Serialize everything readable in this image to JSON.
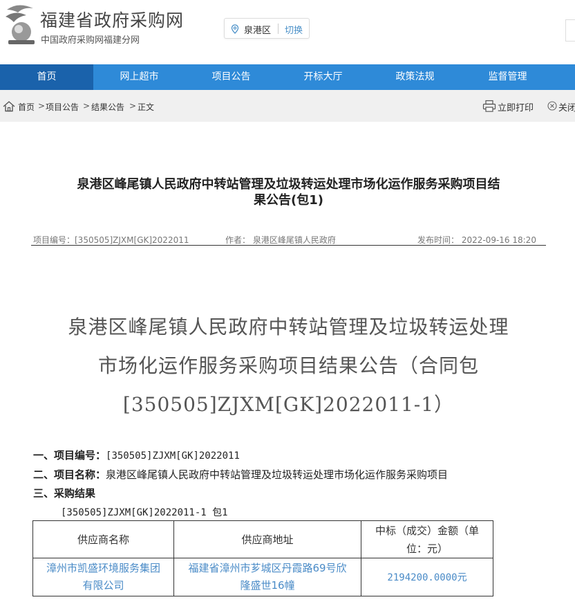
{
  "header": {
    "title": "福建省政府采购网",
    "subtitle": "中国政府采购网福建分网",
    "region": "泉港区",
    "region_switch": "切换"
  },
  "nav": [
    {
      "label": "首页",
      "active": true
    },
    {
      "label": "网上超市"
    },
    {
      "label": "项目公告"
    },
    {
      "label": "开标大厅"
    },
    {
      "label": "政策法规"
    },
    {
      "label": "监督管理"
    }
  ],
  "breadcrumb": {
    "items": [
      "首页",
      "项目公告",
      "结果公告",
      "正文"
    ],
    "separator": ">",
    "print": "立即打印",
    "close": "关闭"
  },
  "article": {
    "title_line1": "泉港区峰尾镇人民政府中转站管理及垃圾转运处理市场化运作服务采购项目结",
    "title_line2": "果公告(包1)",
    "meta_code": "项目编号：[350505]ZJXM[GK]2022011",
    "meta_author": "作者： 泉港区峰尾镇人民政府",
    "meta_time": "发布时间： 2022-09-16 18:20",
    "big_title_line1": "泉港区峰尾镇人民政府中转站管理及垃圾转运处理",
    "big_title_line2": "市场化运作服务采购项目结果公告（合同包",
    "big_title_line3": "[350505]ZJXM[GK]2022011-1）",
    "s1_label": "一、项目编号：",
    "s1_value": "[350505]ZJXM[GK]2022011",
    "s2_label": "二、项目名称：",
    "s2_value": "泉港区峰尾镇人民政府中转站管理及垃圾转运处理市场化运作服务采购项目",
    "s3_label": "三、采购结果",
    "package": "[350505]ZJXM[GK]2022011-1 包1"
  },
  "table": {
    "headers": [
      "供应商名称",
      "供应商地址",
      "中标（成交）金额（单位：元）"
    ],
    "header_amount_l1": "中标（成交）金额（单",
    "header_amount_l2": "位：元）",
    "row": {
      "name_l1": "漳州市凯盛环境服务集团",
      "name_l2": "有限公司",
      "addr_l1": "福建省漳州市芗城区丹霞路69号欣",
      "addr_l2": "隆盛世16幢",
      "amount": "2194200.0000元"
    }
  }
}
